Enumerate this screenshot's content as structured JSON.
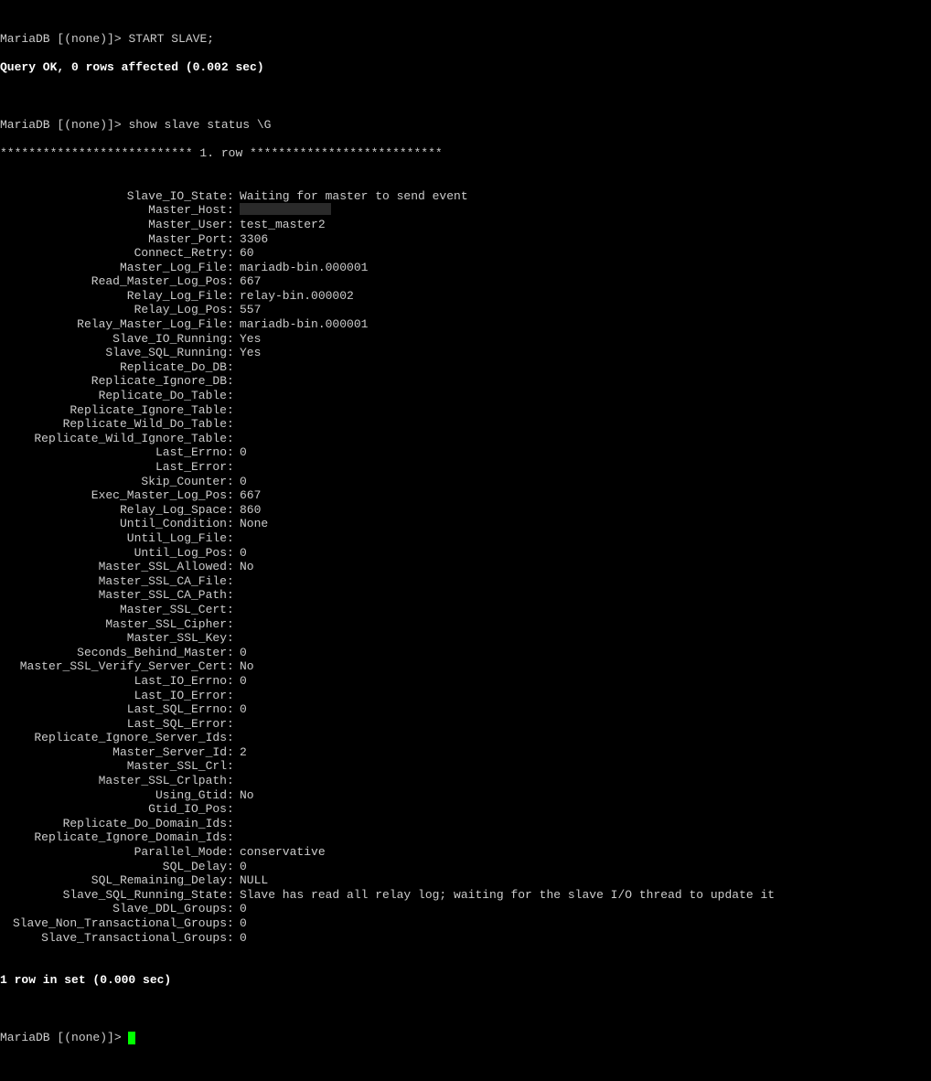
{
  "prompt": "MariaDB [(none)]>",
  "cmd_start_slave": "START SLAVE;",
  "result_start_slave": "Query OK, 0 rows affected (0.002 sec)",
  "cmd_show_status": "show slave status \\G",
  "row_header": "*************************** 1. row ***************************",
  "status": [
    {
      "label": "Slave_IO_State",
      "value": "Waiting for master to send event"
    },
    {
      "label": "Master_Host",
      "redacted": true
    },
    {
      "label": "Master_User",
      "value": "test_master2"
    },
    {
      "label": "Master_Port",
      "value": "3306"
    },
    {
      "label": "Connect_Retry",
      "value": "60"
    },
    {
      "label": "Master_Log_File",
      "value": "mariadb-bin.000001"
    },
    {
      "label": "Read_Master_Log_Pos",
      "value": "667"
    },
    {
      "label": "Relay_Log_File",
      "value": "relay-bin.000002"
    },
    {
      "label": "Relay_Log_Pos",
      "value": "557"
    },
    {
      "label": "Relay_Master_Log_File",
      "value": "mariadb-bin.000001"
    },
    {
      "label": "Slave_IO_Running",
      "value": "Yes"
    },
    {
      "label": "Slave_SQL_Running",
      "value": "Yes"
    },
    {
      "label": "Replicate_Do_DB",
      "value": ""
    },
    {
      "label": "Replicate_Ignore_DB",
      "value": ""
    },
    {
      "label": "Replicate_Do_Table",
      "value": ""
    },
    {
      "label": "Replicate_Ignore_Table",
      "value": ""
    },
    {
      "label": "Replicate_Wild_Do_Table",
      "value": ""
    },
    {
      "label": "Replicate_Wild_Ignore_Table",
      "value": ""
    },
    {
      "label": "Last_Errno",
      "value": "0"
    },
    {
      "label": "Last_Error",
      "value": ""
    },
    {
      "label": "Skip_Counter",
      "value": "0"
    },
    {
      "label": "Exec_Master_Log_Pos",
      "value": "667"
    },
    {
      "label": "Relay_Log_Space",
      "value": "860"
    },
    {
      "label": "Until_Condition",
      "value": "None"
    },
    {
      "label": "Until_Log_File",
      "value": ""
    },
    {
      "label": "Until_Log_Pos",
      "value": "0"
    },
    {
      "label": "Master_SSL_Allowed",
      "value": "No"
    },
    {
      "label": "Master_SSL_CA_File",
      "value": ""
    },
    {
      "label": "Master_SSL_CA_Path",
      "value": ""
    },
    {
      "label": "Master_SSL_Cert",
      "value": ""
    },
    {
      "label": "Master_SSL_Cipher",
      "value": ""
    },
    {
      "label": "Master_SSL_Key",
      "value": ""
    },
    {
      "label": "Seconds_Behind_Master",
      "value": "0"
    },
    {
      "label": "Master_SSL_Verify_Server_Cert",
      "value": "No"
    },
    {
      "label": "Last_IO_Errno",
      "value": "0"
    },
    {
      "label": "Last_IO_Error",
      "value": ""
    },
    {
      "label": "Last_SQL_Errno",
      "value": "0"
    },
    {
      "label": "Last_SQL_Error",
      "value": ""
    },
    {
      "label": "Replicate_Ignore_Server_Ids",
      "value": ""
    },
    {
      "label": "Master_Server_Id",
      "value": "2"
    },
    {
      "label": "Master_SSL_Crl",
      "value": ""
    },
    {
      "label": "Master_SSL_Crlpath",
      "value": ""
    },
    {
      "label": "Using_Gtid",
      "value": "No"
    },
    {
      "label": "Gtid_IO_Pos",
      "value": ""
    },
    {
      "label": "Replicate_Do_Domain_Ids",
      "value": ""
    },
    {
      "label": "Replicate_Ignore_Domain_Ids",
      "value": ""
    },
    {
      "label": "Parallel_Mode",
      "value": "conservative"
    },
    {
      "label": "SQL_Delay",
      "value": "0"
    },
    {
      "label": "SQL_Remaining_Delay",
      "value": "NULL"
    },
    {
      "label": "Slave_SQL_Running_State",
      "value": "Slave has read all relay log; waiting for the slave I/O thread to update it"
    },
    {
      "label": "Slave_DDL_Groups",
      "value": "0"
    },
    {
      "label": "Slave_Non_Transactional_Groups",
      "value": "0"
    },
    {
      "label": "Slave_Transactional_Groups",
      "value": "0"
    }
  ],
  "row_footer": "1 row in set (0.000 sec)"
}
